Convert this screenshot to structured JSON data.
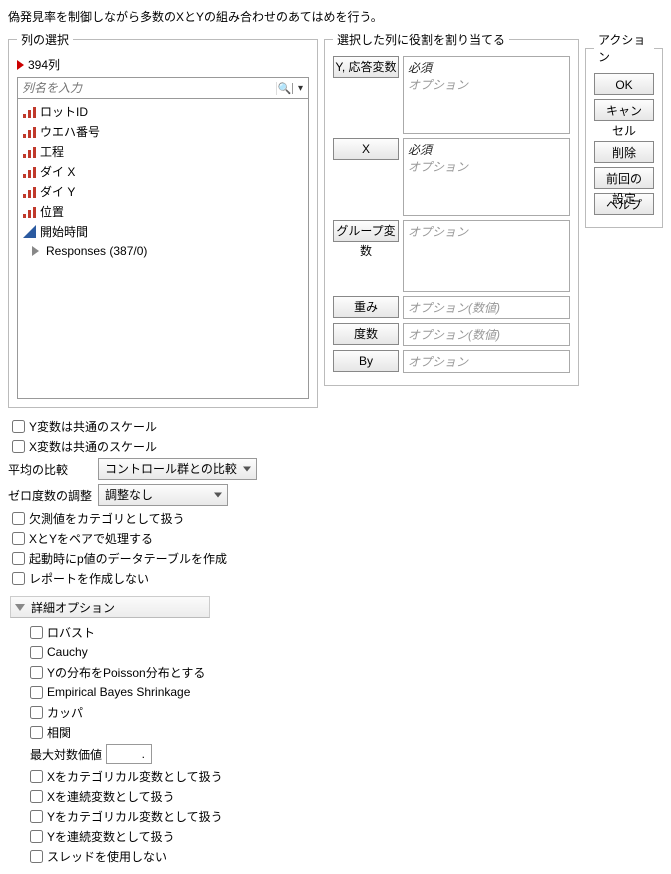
{
  "description": "偽発見率を制御しながら多数のXとYの組み合わせのあてはめを行う。",
  "column_select": {
    "legend": "列の選択",
    "count_label": "394列",
    "search_placeholder": "列名を入力",
    "items": [
      {
        "type": "nominal",
        "label": "ロットID"
      },
      {
        "type": "nominal",
        "label": "ウエハ番号"
      },
      {
        "type": "nominal",
        "label": "工程"
      },
      {
        "type": "nominal",
        "label": "ダイ X"
      },
      {
        "type": "nominal",
        "label": "ダイ Y"
      },
      {
        "type": "nominal",
        "label": "位置"
      },
      {
        "type": "continuous",
        "label": "開始時間"
      },
      {
        "type": "group",
        "label": "Responses (387/0)"
      }
    ]
  },
  "role_assign": {
    "legend": "選択した列に役割を割り当てる",
    "roles": [
      {
        "button": "Y, 応答変数",
        "required": "必須",
        "optional": "オプション",
        "size": "tall"
      },
      {
        "button": "X",
        "required": "必須",
        "optional": "オプション",
        "size": "tall"
      },
      {
        "button": "グループ変数",
        "required": null,
        "optional": "オプション",
        "size": "med"
      },
      {
        "button": "重み",
        "required": null,
        "optional": "オプション(数値)",
        "size": ""
      },
      {
        "button": "度数",
        "required": null,
        "optional": "オプション(数値)",
        "size": ""
      },
      {
        "button": "By",
        "required": null,
        "optional": "オプション",
        "size": ""
      }
    ]
  },
  "actions": {
    "legend": "アクション",
    "ok": "OK",
    "cancel": "キャンセル",
    "remove": "削除",
    "recall": "前回の設定",
    "help": "ヘルプ"
  },
  "options": {
    "y_common_scale": "Y変数は共通のスケール",
    "x_common_scale": "X変数は共通のスケール",
    "compare_means_label": "平均の比較",
    "compare_means_value": "コントロール群との比較",
    "zero_freq_label": "ゼロ度数の調整",
    "zero_freq_value": "調整なし",
    "missing_as_cat": "欠測値をカテゴリとして扱う",
    "pair_xy": "XとYをペアで処理する",
    "pval_table": "起動時にp値のデータテーブルを作成",
    "no_report": "レポートを作成しない"
  },
  "advanced": {
    "header": "詳細オプション",
    "robust": "ロバスト",
    "cauchy": "Cauchy",
    "poisson": "Yの分布をPoisson分布とする",
    "ebs": "Empirical Bayes Shrinkage",
    "kappa": "カッパ",
    "corr": "相関",
    "max_log_label": "最大対数価値",
    "max_log_value": ".",
    "x_as_cat": "Xをカテゴリカル変数として扱う",
    "x_as_cont": "Xを連続変数として扱う",
    "y_as_cat": "Yをカテゴリカル変数として扱う",
    "y_as_cont": "Yを連続変数として扱う",
    "no_threads": "スレッドを使用しない"
  }
}
